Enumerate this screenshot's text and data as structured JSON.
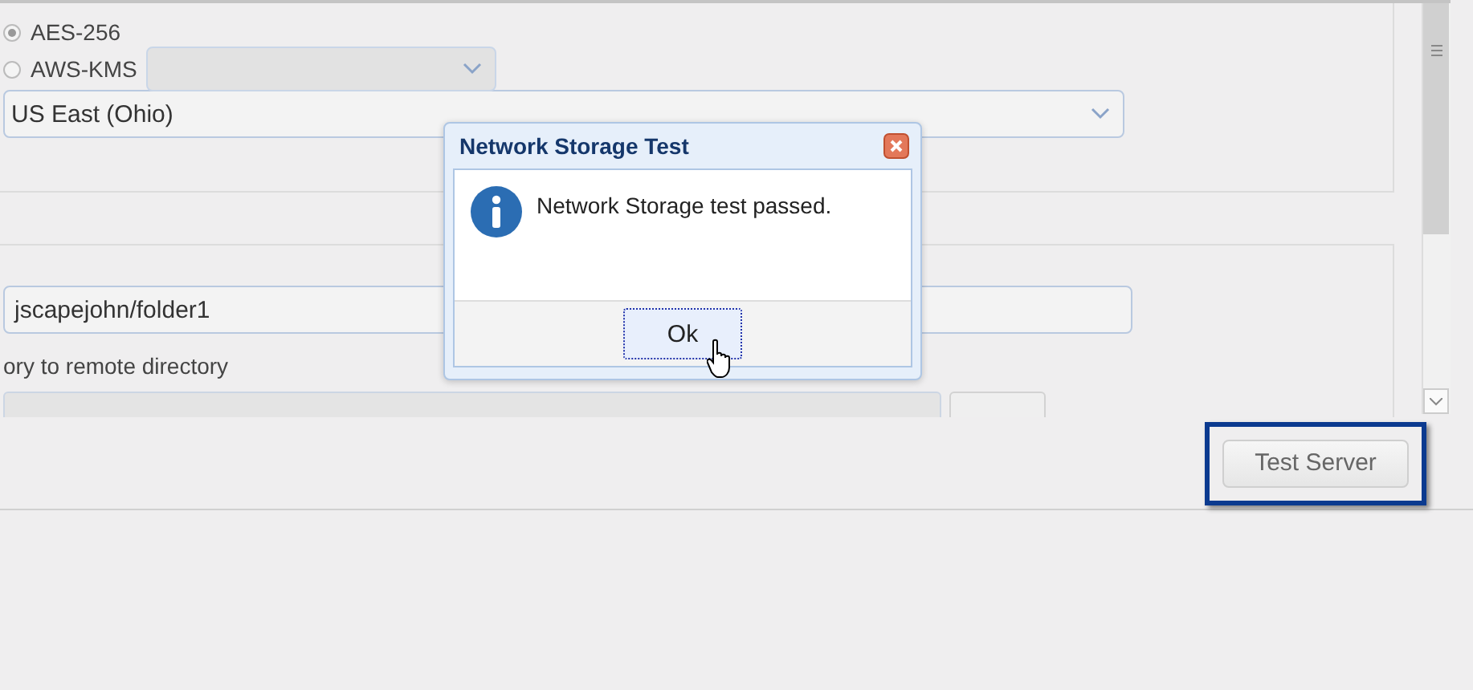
{
  "encryption": {
    "options": [
      {
        "label": "AES-256",
        "selected": true
      },
      {
        "label": "AWS-KMS",
        "selected": false
      }
    ],
    "region": {
      "value": "US East (Ohio)"
    }
  },
  "remote": {
    "path_field": {
      "value": "jscapejohn/folder1"
    },
    "label": "ory to remote directory"
  },
  "test_button": {
    "label": "Test Server",
    "highlighted": true
  },
  "dialog": {
    "title": "Network Storage Test",
    "message": "Network Storage test passed.",
    "ok_button": "Ok"
  }
}
